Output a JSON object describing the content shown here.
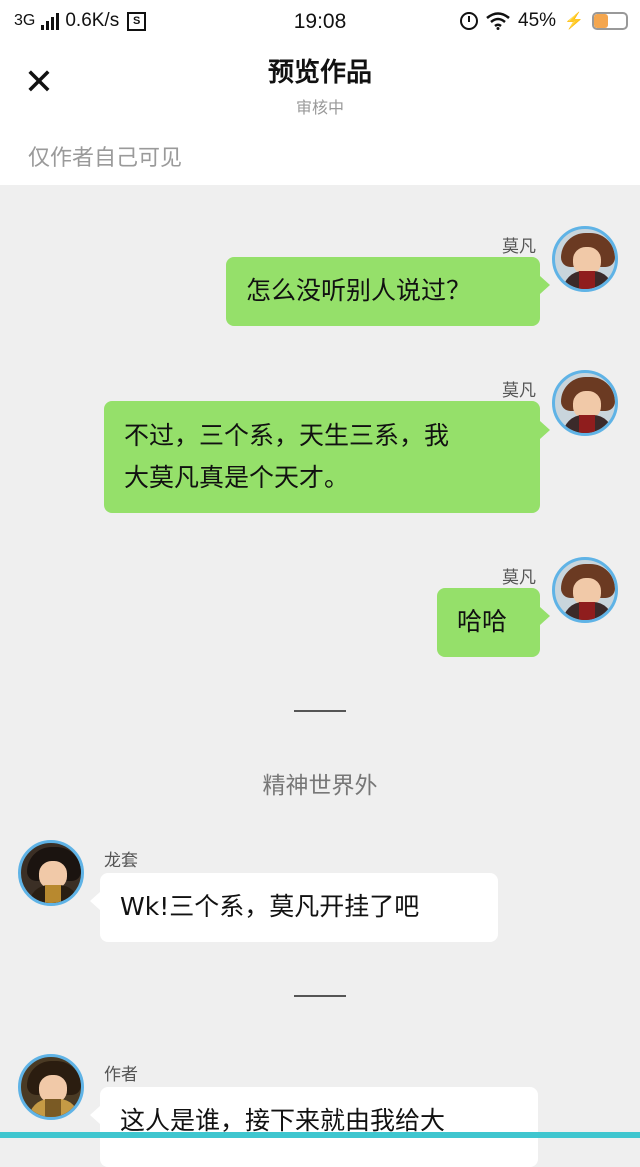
{
  "status_bar": {
    "network": "3G",
    "speed": "0.6K/s",
    "sim_label": "S",
    "time": "19:08",
    "battery": "45%",
    "battery_level": 0.45,
    "icons": [
      "signal-icon",
      "sim-icon",
      "alarm-icon",
      "wifi-icon",
      "charging-icon",
      "battery-icon"
    ]
  },
  "header": {
    "close_icon": "✕",
    "title": "预览作品",
    "subtitle": "审核中",
    "visibility_note": "仅作者自己可见"
  },
  "messages": [
    {
      "sender": "莫凡",
      "side": "right",
      "text": "怎么没听别人说过？"
    },
    {
      "sender": "莫凡",
      "side": "right",
      "lines": [
        "不过，三个系，天生三系，我",
        "大莫凡真是个天才。"
      ]
    },
    {
      "sender": "莫凡",
      "side": "right",
      "text": "哈哈"
    },
    {
      "scene": "精神世界外"
    },
    {
      "sender": "龙套",
      "side": "left",
      "text": "Wk!三个系，莫凡开挂了吧"
    },
    {
      "sender": "作者",
      "side": "left",
      "text": "这人是谁，接下来就由我给大"
    }
  ],
  "colors": {
    "bubble_green": "#95e06a",
    "bubble_white": "#ffffff",
    "background": "#efefef",
    "avatar_border": "#5fb3e6",
    "bottom_bar": "#3fc6cf"
  }
}
